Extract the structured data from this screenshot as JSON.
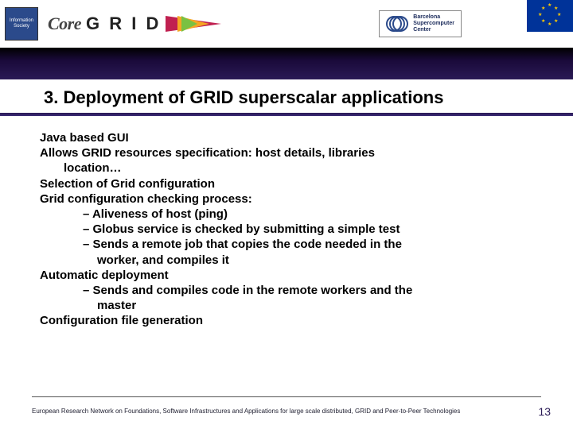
{
  "header": {
    "info_society": "Information Society",
    "logo_core": "Core",
    "logo_grid": "G R I D",
    "bsc_line1": "Barcelona",
    "bsc_line2": "Supercomputer",
    "bsc_line3": "Center"
  },
  "title": "3.   Deployment of GRID superscalar applications",
  "body": {
    "p1": "Java based GUI",
    "p2a": "Allows GRID resources specification: host details, libraries",
    "p2b": "location…",
    "p3": "Selection of Grid configuration",
    "p4": "Grid configuration checking process:",
    "b1": "Aliveness of host (ping)",
    "b2": "Globus service is checked by submitting a simple test",
    "b3a": "Sends a remote job that copies the code needed in the",
    "b3b": "worker, and compiles it",
    "p5": "Automatic deployment",
    "b4a": "Sends and compiles code in the remote workers and the",
    "b4b": "master",
    "p6": "Configuration file generation"
  },
  "footer": "European Research Network on Foundations, Software Infrastructures and Applications for large scale distributed, GRID and Peer-to-Peer Technologies",
  "page": "13"
}
